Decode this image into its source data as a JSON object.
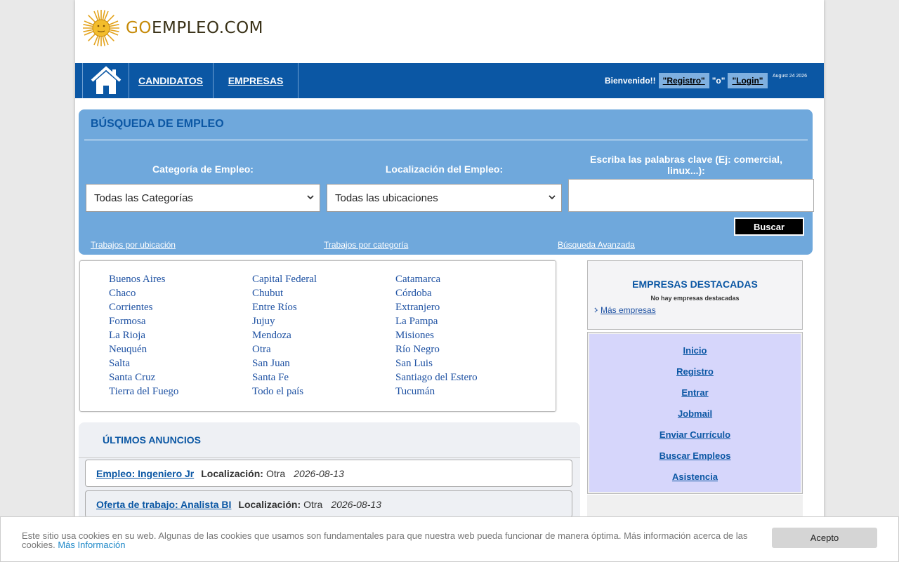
{
  "header": {
    "logo_go": "GO",
    "logo_empleo": "EMPLEO",
    "logo_dotcom": ".COM"
  },
  "nav": {
    "items": [
      {
        "label": "CANDIDATOS"
      },
      {
        "label": "EMPRESAS"
      }
    ],
    "welcome": "Bienvenido!!",
    "registro": "\"Registro\"",
    "or": "\"o\"",
    "login": "\"Login\"",
    "date": "August 24 2026"
  },
  "search": {
    "title": "BÚSQUEDA DE EMPLEO",
    "category_label": "Categoría de Empleo:",
    "location_label": "Localización del Empleo:",
    "keywords_label": "Escriba las palabras clave (Ej: comercial, linux...):",
    "category_value": "Todas las Categorías",
    "location_value": "Todas las ubicaciones",
    "keywords_value": "",
    "button": "Buscar",
    "links": [
      "Trabajos por ubicación",
      "Trabajos por categoría",
      "Búsqueda Avanzada"
    ]
  },
  "locations": [
    "Buenos Aires",
    "Capital Federal",
    "Catamarca",
    "Chaco",
    "Chubut",
    "Córdoba",
    "Corrientes",
    "Entre Ríos",
    "Extranjero",
    "Formosa",
    "Jujuy",
    "La Pampa",
    "La Rioja",
    "Mendoza",
    "Misiones",
    "Neuquén",
    "Otra",
    "Río Negro",
    "Salta",
    "San Juan",
    "San Luis",
    "Santa Cruz",
    "Santa Fe",
    "Santiago del Estero",
    "Tierra del Fuego",
    "Todo el país",
    "Tucumán"
  ],
  "ultimos": {
    "title": "ÚLTIMOS ANUNCIOS",
    "location_label": "Localización:",
    "ads": [
      {
        "title": "Empleo: Ingeniero Jr",
        "location": "Otra",
        "date": "2026-08-13"
      },
      {
        "title": "Oferta de trabajo: Analista BI",
        "location": "Otra",
        "date": "2026-08-13"
      }
    ]
  },
  "empresas": {
    "title": "EMPRESAS DESTACADAS",
    "none": "No hay empresas destacadas",
    "more": "Más empresas"
  },
  "menu": [
    "Inicio",
    "Registro",
    "Entrar",
    "Jobmail",
    "Enviar Currículo",
    "Buscar Empleos",
    "Asistencia"
  ],
  "cookie": {
    "text": "Este sitio usa cookies en su web. Algunas de las cookies que usamos son fundamentales para que nuestra web pueda funcionar de manera óptima. Más información acerca de las cookies.",
    "more": "Más Información",
    "accept": "Acepto"
  },
  "colors": {
    "nav_bg": "#0b57a4",
    "search_bg": "#6fa8dc",
    "menu_bg": "#d6d6fb"
  }
}
